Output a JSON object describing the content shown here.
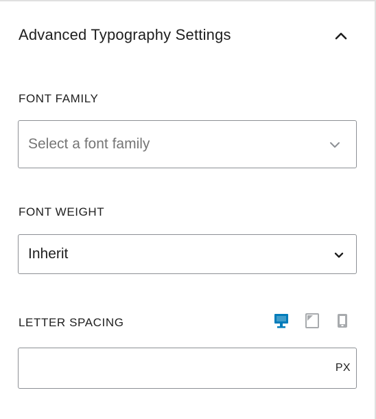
{
  "panel": {
    "title": "Advanced Typography Settings",
    "toggle_icon": "chevron-up-icon"
  },
  "font_family": {
    "label": "FONT FAMILY",
    "placeholder": "Select a font family",
    "icon": "chevron-down-icon"
  },
  "font_weight": {
    "label": "FONT WEIGHT",
    "value": "Inherit",
    "icon": "chevron-down-icon"
  },
  "letter_spacing": {
    "label": "LETTER SPACING",
    "value": "",
    "unit": "PX",
    "devices": [
      {
        "name": "desktop",
        "active": true
      },
      {
        "name": "tablet",
        "active": false
      },
      {
        "name": "mobile",
        "active": false
      }
    ]
  },
  "colors": {
    "accent": "#007cba",
    "border": "#8c8f94",
    "placeholder": "#757575",
    "inactive_icon": "#a7aaad",
    "text": "#1e1e1e"
  }
}
